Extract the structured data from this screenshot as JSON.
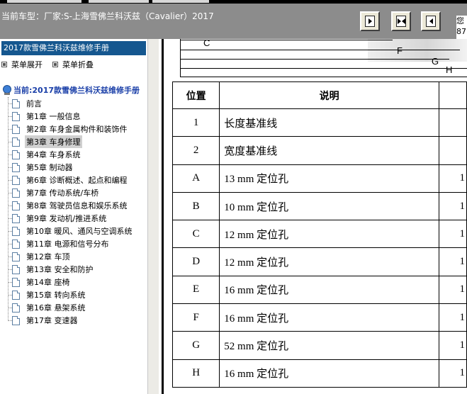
{
  "header": {
    "title": "当前车型：厂家:S-上海雪佛兰科沃兹（Cavalier）2017",
    "corner_line1": "您",
    "corner_line2": "87"
  },
  "left_panel": {
    "manual_title": "2017款雪佛兰科沃兹维修手册",
    "expand_label": "菜单展开",
    "collapse_label": "菜单折叠",
    "tree_root": "当前:2017款雪佛兰科沃兹维修手册",
    "items": [
      "前言",
      "第1章 一般信息",
      "第2章 车身金属构件和装饰件",
      "第3章 车身修理",
      "第4章 车身系统",
      "第5章 制动器",
      "第6章 诊断概述、起点和编程",
      "第7章 传动系统/车桥",
      "第8章 驾驶员信息和娱乐系统",
      "第9章 发动机/推进系统",
      "第10章 暖风、通风与空调系统",
      "第11章 电源和信号分布",
      "第12章 车顶",
      "第13章 安全和防护",
      "第14章 座椅",
      "第15章 转向系统",
      "第16章 悬架系统",
      "第17章 变速器"
    ],
    "selected_index": 3
  },
  "figure": {
    "labels": [
      "C",
      "F",
      "G",
      "H"
    ]
  },
  "table": {
    "headers": [
      "位置",
      "说明",
      ""
    ],
    "rows": [
      {
        "pos": "1",
        "desc": "长度基准线",
        "extra": ""
      },
      {
        "pos": "2",
        "desc": "宽度基准线",
        "extra": ""
      },
      {
        "pos": "A",
        "desc": "13 mm 定位孔",
        "extra": "1"
      },
      {
        "pos": "B",
        "desc": "10 mm 定位孔",
        "extra": "1"
      },
      {
        "pos": "C",
        "desc": "12 mm 定位孔",
        "extra": "1"
      },
      {
        "pos": "D",
        "desc": "12 mm 定位孔",
        "extra": "1"
      },
      {
        "pos": "E",
        "desc": "16 mm 定位孔",
        "extra": "1"
      },
      {
        "pos": "F",
        "desc": "16 mm 定位孔",
        "extra": "1"
      },
      {
        "pos": "G",
        "desc": "52 mm 定位孔",
        "extra": "1"
      },
      {
        "pos": "H",
        "desc": "16 mm 定位孔",
        "extra": "1"
      }
    ]
  }
}
